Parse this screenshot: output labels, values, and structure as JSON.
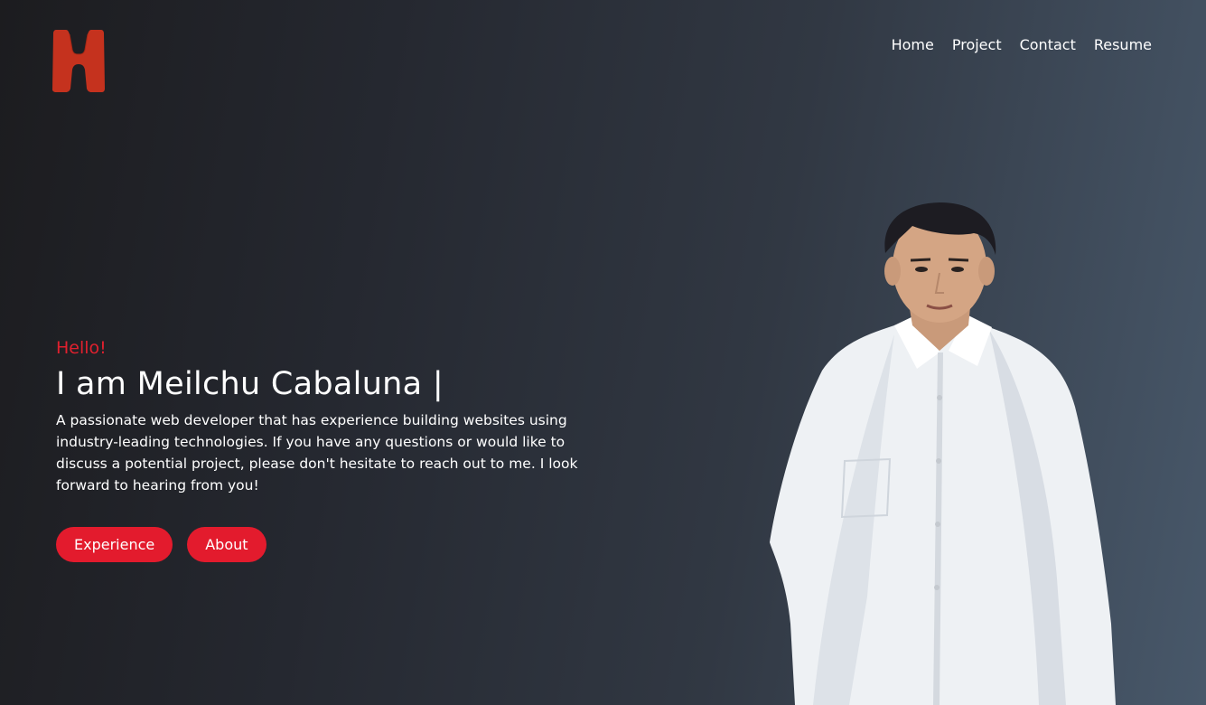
{
  "logo": {
    "icon": "brand-logo-icon",
    "color": "#c5321e"
  },
  "nav": {
    "items": [
      {
        "label": "Home"
      },
      {
        "label": "Project"
      },
      {
        "label": "Contact"
      },
      {
        "label": "Resume"
      }
    ]
  },
  "hero": {
    "greeting": "Hello!",
    "title": "I am Meilchu Cabaluna |",
    "description": "A passionate web developer that has experience building websites using industry-leading technologies. If you have any questions or would like to discuss a potential project, please don't hesitate to reach out to me. I look forward to hearing from you!",
    "buttons": [
      {
        "label": "Experience"
      },
      {
        "label": "About"
      }
    ]
  },
  "colors": {
    "accent": "#e31b2d",
    "greeting": "#e0202e",
    "text": "#ffffff"
  },
  "portrait": {
    "icon": "profile-photo"
  }
}
